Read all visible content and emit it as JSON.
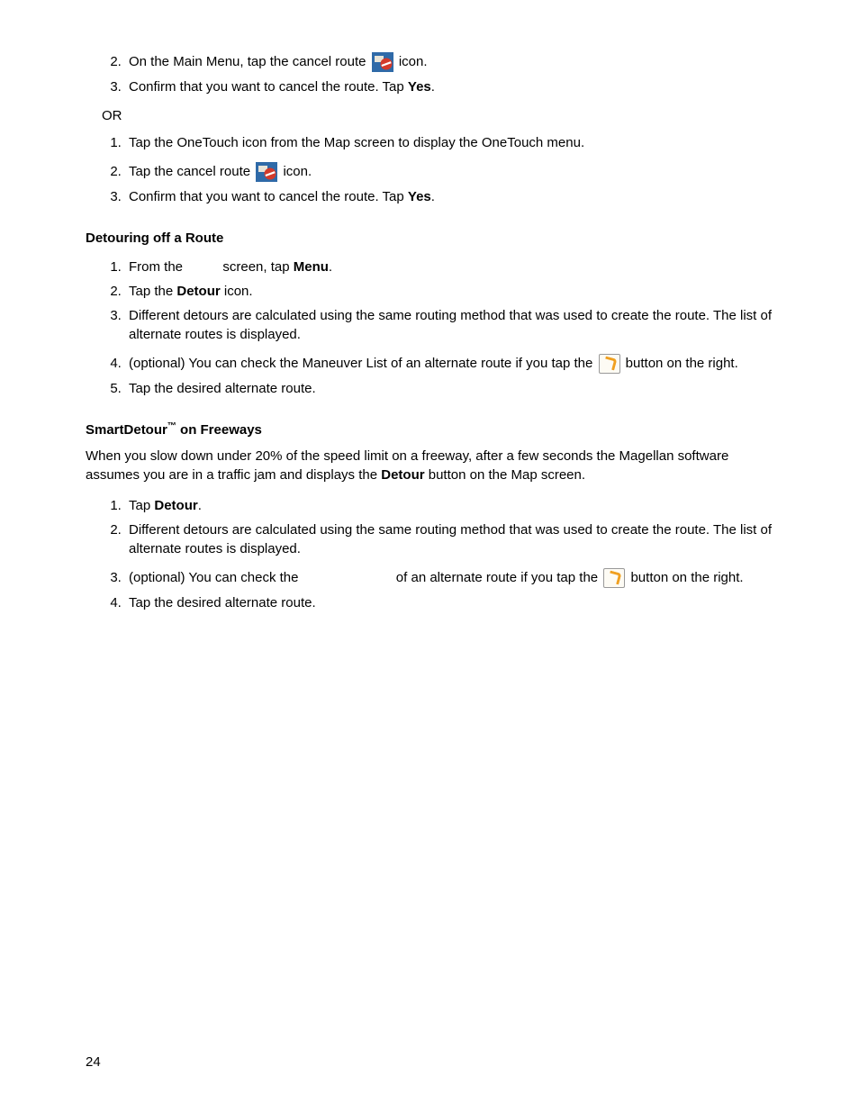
{
  "listA": {
    "2_a": "On the Main Menu, tap the cancel route ",
    "2_b": " icon.",
    "3_a": "Confirm that you want to cancel the route. Tap ",
    "3_yes": "Yes",
    "3_b": "."
  },
  "or": "OR",
  "listB": {
    "1": "Tap the OneTouch icon from the Map screen to display the OneTouch menu.",
    "2_a": "Tap the cancel route ",
    "2_b": " icon.",
    "3_a": "Confirm that you want to cancel the route. Tap ",
    "3_yes": "Yes",
    "3_b": "."
  },
  "h_detour": "Detouring off a Route",
  "listC": {
    "1_a": "From the ",
    "1_b": " screen, tap ",
    "1_menu": "Menu",
    "1_c": ".",
    "2_a": "Tap the ",
    "2_det": "Detour",
    "2_b": " icon.",
    "3": "Different detours are calculated using the same routing method that was used to create the route. The list of alternate routes is displayed.",
    "4_a": "(optional) You can check the Maneuver List of an alternate route if you tap the ",
    "4_b": " button on the right.",
    "5": "Tap the desired alternate route."
  },
  "h_smart_a": "SmartDetour",
  "h_smart_tm": "™",
  "h_smart_b": " on Freeways",
  "p_smart_a": "When you slow down under 20% of the speed limit on a freeway, after a few seconds the Magellan software assumes you are in a traffic jam and displays the ",
  "p_smart_det": "Detour",
  "p_smart_b": " button on the Map screen.",
  "listD": {
    "1_a": "Tap ",
    "1_det": "Detour",
    "1_b": ".",
    "2": "Different detours are calculated using the same routing method that was used to create the route. The list of alternate routes is displayed.",
    "3_a": "(optional) You can check the ",
    "3_b": " of an alternate route if you tap the ",
    "3_c": " button on the right.",
    "4": "Tap the desired alternate route."
  },
  "pagenum": "24",
  "icons": {
    "cancel": "cancel-route-icon",
    "maneuver": "maneuver-list-icon"
  }
}
